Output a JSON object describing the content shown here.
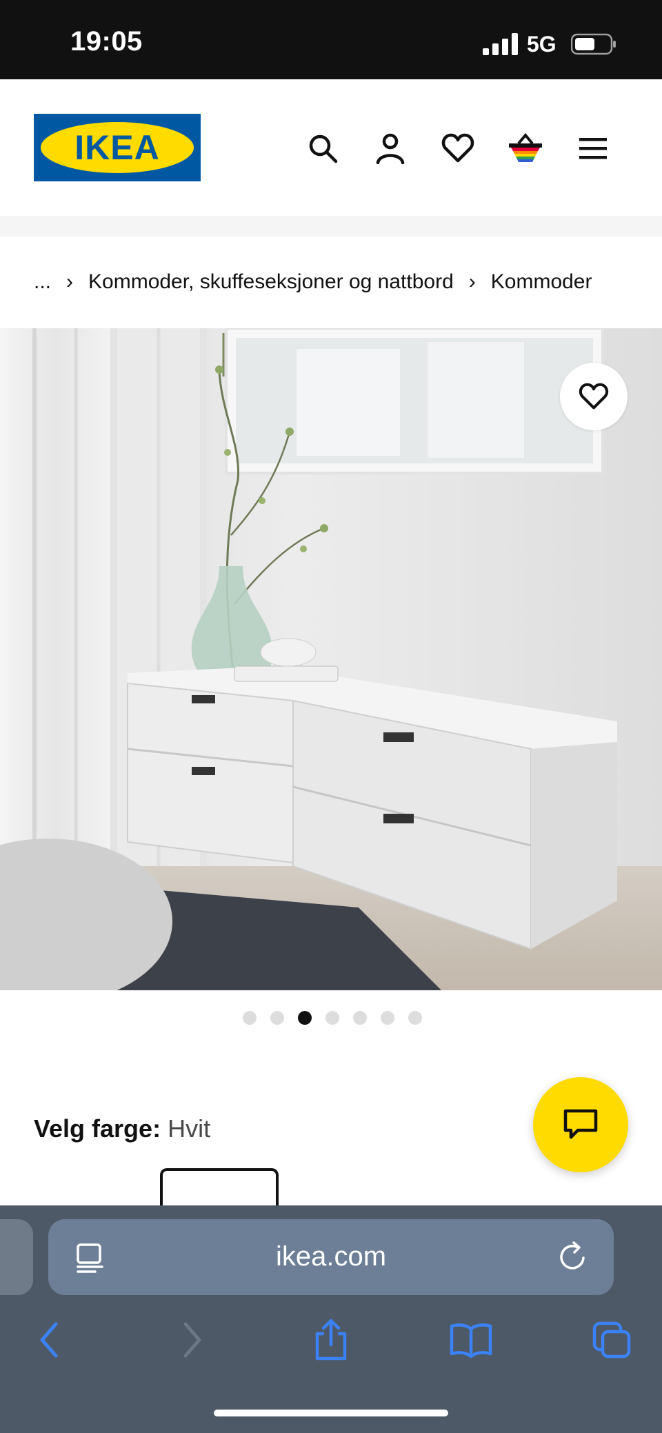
{
  "status": {
    "time": "19:05",
    "network": "5G"
  },
  "header": {
    "logo_text": "IKEA"
  },
  "breadcrumb": {
    "ellipsis": "...",
    "items": [
      "Kommoder, skuffeseksjoner og nattbord",
      "Kommoder"
    ]
  },
  "carousel": {
    "count": 7,
    "active_index": 2
  },
  "color": {
    "label": "Velg farge:",
    "value": "Hvit"
  },
  "browser": {
    "url": "ikea.com"
  },
  "colors": {
    "ikea_blue": "#0058a3",
    "ikea_yellow": "#ffdb00",
    "browser_bar": "#4e5967",
    "browser_accent": "#3b82f6"
  }
}
